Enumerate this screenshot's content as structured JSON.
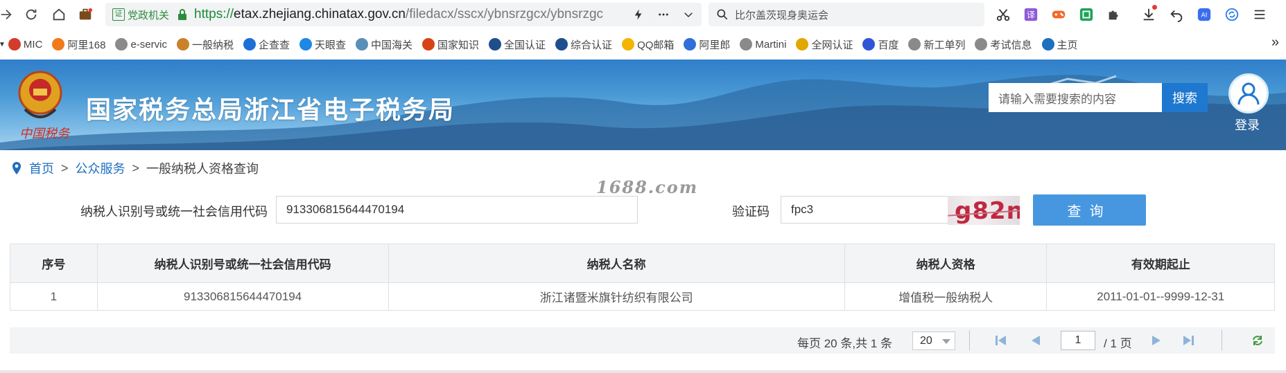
{
  "browser": {
    "cert_badge": "证",
    "cert_label": "党政机关",
    "url_proto": "https://",
    "url_host": "etax.zhejiang.chinatax.gov.cn",
    "url_path": "/filedacx/sscx/ybnsrzgcx/ybnsrzgc",
    "search_hint": "比尔盖茨现身奥运会"
  },
  "bookmarks": [
    {
      "label": "MIC",
      "color": "#d33b2c"
    },
    {
      "label": "阿里168",
      "color": "#f07a1a"
    },
    {
      "label": "e-servic",
      "color": "#8a8a8a"
    },
    {
      "label": "一般纳税",
      "color": "#c9822b"
    },
    {
      "label": "企查查",
      "color": "#1d6fd6"
    },
    {
      "label": "天眼查",
      "color": "#1e88e5"
    },
    {
      "label": "中国海关",
      "color": "#5a8fb8"
    },
    {
      "label": "国家知识",
      "color": "#d84315"
    },
    {
      "label": "全国认证",
      "color": "#1f4e8c"
    },
    {
      "label": "综合认证",
      "color": "#1f4e8c"
    },
    {
      "label": "QQ邮箱",
      "color": "#f4b400"
    },
    {
      "label": "阿里郎",
      "color": "#2e6fd8"
    },
    {
      "label": "Martini",
      "color": "#8a8a8a"
    },
    {
      "label": "全网认证",
      "color": "#e0a800"
    },
    {
      "label": "百度",
      "color": "#2f56d6"
    },
    {
      "label": "新工单列",
      "color": "#8a8a8a"
    },
    {
      "label": "考试信息",
      "color": "#8a8a8a"
    },
    {
      "label": "主页",
      "color": "#1e6fc0"
    }
  ],
  "bookmarks_more": "»",
  "site": {
    "title": "国家税务总局浙江省电子税务局",
    "emblem_sign": "中国税务",
    "search_placeholder": "请输入需要搜索的内容",
    "search_button": "搜索",
    "login_label": "登录"
  },
  "breadcrumb": {
    "home": "首页",
    "sep1": ">",
    "section": "公众服务",
    "sep2": ">",
    "current": "一般纳税人资格查询"
  },
  "watermark": "1688.com",
  "form": {
    "taxid_label": "纳税人识别号或统一社会信用代码",
    "taxid_value": "913306815644470194",
    "captcha_label": "验证码",
    "captcha_value": "fpc3",
    "captcha_image_text": "g82n",
    "query_button": "查询"
  },
  "table": {
    "headers": [
      "序号",
      "纳税人识别号或统一社会信用代码",
      "纳税人名称",
      "纳税人资格",
      "有效期起止"
    ],
    "rows": [
      [
        "1",
        "913306815644470194",
        "浙江诸暨米旗针纺织有限公司",
        "增值税一般纳税人",
        "2011-01-01--9999-12-31"
      ]
    ]
  },
  "pager": {
    "info": "每页 20 条,共 1 条",
    "page_size": "20",
    "current_page": "1",
    "total_pages": "/ 1 页"
  },
  "colors": {
    "accent": "#1e78d0",
    "query_button": "#4797e0",
    "link": "#1e6fc0"
  }
}
